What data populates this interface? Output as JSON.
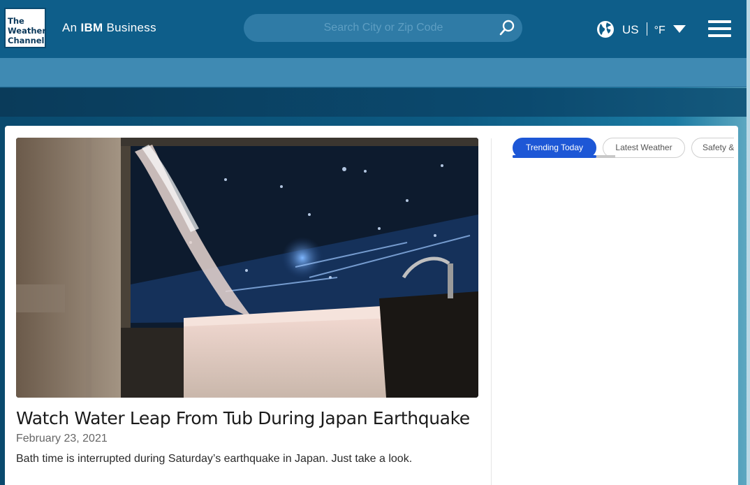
{
  "header": {
    "logo_lines": [
      "The",
      "Weather",
      "Channel"
    ],
    "tagline_prefix": "An",
    "tagline_brand": "IBM",
    "tagline_suffix": "Business",
    "search_placeholder": "Search City or Zip Code",
    "search_icon": "search-icon",
    "globe_icon": "globe-icon",
    "region": "US",
    "unit": "°F",
    "dropdown_icon": "caret-down-icon",
    "menu_icon": "hamburger-menu-icon"
  },
  "article": {
    "title": "Watch Water Leap From Tub During Japan Earthquake",
    "date": "February 23, 2021",
    "description": "Bath time is interrupted during Saturday’s earthquake in Japan. Just take a look."
  },
  "sidebar": {
    "tabs": [
      {
        "label": "Trending Today",
        "active": true
      },
      {
        "label": "Latest Weather",
        "active": false
      },
      {
        "label": "Safety &",
        "active": false
      }
    ]
  },
  "colors": {
    "header_bg": "#0e5e8a",
    "subnav_bg": "#3f8ab3",
    "active_tab": "#1d57d6"
  }
}
